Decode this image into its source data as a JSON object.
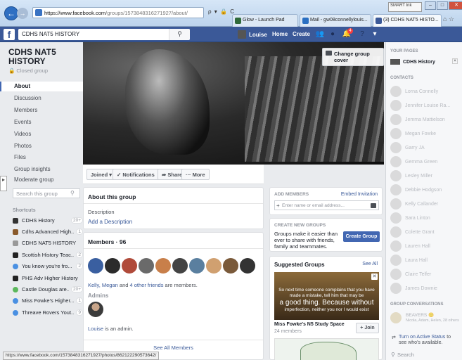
{
  "browser": {
    "address_host": "https://www.facebook.com",
    "address_path": "/groups/1573848316271927/about/",
    "address_controls": "ρ ▾ 🔒 C",
    "tabs": [
      {
        "label": "Glow - Launch Pad",
        "color": "#2f6a3a"
      },
      {
        "label": "Mail - gw08connellylouis...",
        "color": "#2a6fc2"
      },
      {
        "label": "(3) CDHS NAT5 HISTO...",
        "color": "#3b5998"
      }
    ],
    "smart_ink": "SMART Ink",
    "status_url": "https://www.facebook.com/1573848316271927/photos/862122290573642/"
  },
  "fb_bar": {
    "logo": "f",
    "search_value": "CDHS NAT5 HISTORY",
    "user_name": "Louise",
    "home_label": "Home",
    "create_label": "Create",
    "notif_count": "4"
  },
  "left": {
    "group_name": "CDHS NAT5 HISTORY",
    "closed_group": "🔒 Closed group",
    "nav": [
      "About",
      "Discussion",
      "Members",
      "Events",
      "Videos",
      "Photos",
      "Files",
      "Group insights",
      "Moderate group"
    ],
    "active_nav": "About",
    "search_placeholder": "Search this group",
    "shortcuts_title": "Shortcuts",
    "shortcuts": [
      {
        "label": "CDHS History",
        "count": "20+",
        "color": "#333"
      },
      {
        "label": "Cdhs Advanced High...",
        "count": "1",
        "color": "#8a5a2b"
      },
      {
        "label": "CDHS NAT5 HISTORY",
        "count": "",
        "color": "#999"
      },
      {
        "label": "Scottish History Teac...",
        "count": "2",
        "color": "#222"
      },
      {
        "label": "You know you're fro...",
        "count": "2",
        "color": "#4a90e2"
      },
      {
        "label": "PHS Adv Higher History",
        "count": "",
        "color": "#222"
      },
      {
        "label": "Castle Douglas are...",
        "count": "20+",
        "color": "#5cb85c"
      },
      {
        "label": "Miss Fowke's Higher...",
        "count": "1",
        "color": "#4a90e2"
      },
      {
        "label": "Threave Rovers Yout...",
        "count": "9",
        "color": "#4a90e2"
      }
    ]
  },
  "cover": {
    "change_cover_label": "Change group cover"
  },
  "actions": {
    "joined": "Joined ▾",
    "notifications": "✓ Notifications",
    "share": "➦ Share",
    "more": "··· More"
  },
  "about": {
    "title": "About this group",
    "description_label": "Description",
    "add_description": "Add a Description"
  },
  "members": {
    "title": "Members · 96",
    "avatar_colors": [
      "#3a5fa0",
      "#2b2b2b",
      "#b04a3a",
      "#6a6a6a",
      "#c87f4a",
      "#444",
      "#5a7f9f",
      "#d0a070",
      "#7a5a3a",
      "#333"
    ],
    "line_names": "Kelly, Megan",
    "line_and": " and ",
    "line_friends": "4 other friends",
    "line_end": " are members.",
    "admins_label": "Admins",
    "admin_name": "Louise",
    "admin_suffix": " is an admin.",
    "see_all": "See All Members"
  },
  "add_members": {
    "title": "ADD MEMBERS",
    "embed": "Embed Invitation",
    "placeholder": "Enter name or email address..."
  },
  "create_groups": {
    "title": "CREATE NEW GROUPS",
    "text": "Groups make it easier than ever to share with friends, family and teammates.",
    "button": "Create Group"
  },
  "suggested": {
    "title": "Suggested Groups",
    "see_all": "See All",
    "quote_1": "So next time someone complains that you have made a mistake, tell him that may be",
    "quote_big": "a good thing. Because without",
    "quote_2": "imperfection, neither you nor I would exist",
    "group_name": "Miss Fowke's N5 Study Space",
    "members": "24 members",
    "join": "+ Join"
  },
  "chat": {
    "your_pages": "YOUR PAGES",
    "page_name": "CDHS History",
    "contacts_head": "CONTACTS",
    "contacts": [
      "Lorna Connelly",
      "Jennifer Louise Ra...",
      "Jemma Mattielson",
      "Megan Fowke",
      "Garry JA",
      "Gemma Green",
      "Lesley Miller",
      "Debbie Hodgson",
      "Kelly Callander",
      "Sara Linton",
      "Colette Grant",
      "Lauren Hall",
      "Laura Hall",
      "Claire Telfer",
      "James Downie"
    ],
    "conversations_head": "GROUP CONVERSATIONS",
    "convo_name": "BEAVERS 🙂",
    "convo_sub": "Nicola, Adam, Helen, 28 others",
    "active_text": "Turn on Active Status",
    "active_suffix": " to see who's available.",
    "search_placeholder": "Search"
  }
}
